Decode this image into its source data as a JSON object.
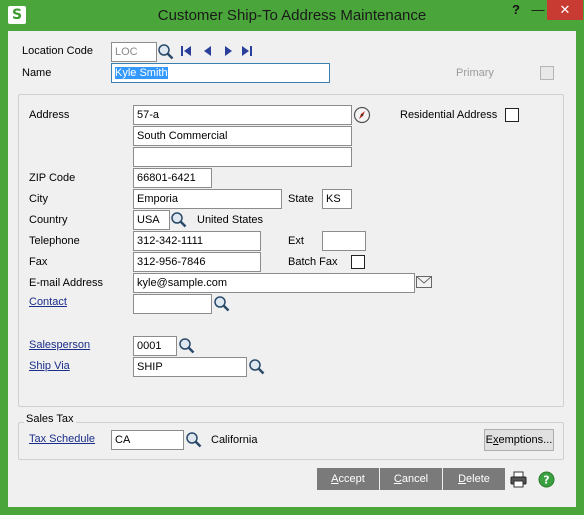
{
  "window": {
    "title": "Customer Ship-To Address Maintenance",
    "app_icon_letter": "S",
    "help_glyph": "?",
    "minimize_glyph": "—",
    "close_glyph": "✕"
  },
  "header": {
    "location_code_label": "Location Code",
    "location_code_value": "LOC",
    "name_label": "Name",
    "name_value": "Kyle Smith",
    "primary_label": "Primary"
  },
  "address": {
    "address_label": "Address",
    "line1": "57-a",
    "line2": "South Commercial",
    "line3": "",
    "residential_label": "Residential Address",
    "zip_label": "ZIP Code",
    "zip_value": "66801-6421",
    "city_label": "City",
    "city_value": "Emporia",
    "state_label": "State",
    "state_value": "KS",
    "country_label": "Country",
    "country_value": "USA",
    "country_name": "United States",
    "telephone_label": "Telephone",
    "telephone_value": "312-342-1111",
    "ext_label": "Ext",
    "ext_value": "",
    "fax_label": "Fax",
    "fax_value": "312-956-7846",
    "batch_fax_label": "Batch Fax",
    "email_label": "E-mail Address",
    "email_value": "kyle@sample.com",
    "contact_label": "Contact",
    "contact_value": "",
    "salesperson_label": "Salesperson",
    "salesperson_value": "0001",
    "ship_via_label": "Ship Via",
    "ship_via_value": "SHIP"
  },
  "sales_tax": {
    "group_label": "Sales Tax",
    "tax_schedule_label": "Tax Schedule",
    "tax_schedule_value": "CA",
    "tax_schedule_name": "California",
    "exemptions_label_pre": "E",
    "exemptions_label_ul": "x",
    "exemptions_label_post": "emptions..."
  },
  "footer": {
    "accept_ul": "A",
    "accept_rest": "ccept",
    "cancel_ul": "C",
    "cancel_rest": "ancel",
    "delete_ul": "D",
    "delete_rest": "elete"
  },
  "colors": {
    "titlebar": "#4aa63a",
    "close": "#c73b32",
    "button": "#7a7a7a",
    "link": "#1a2e8a"
  }
}
